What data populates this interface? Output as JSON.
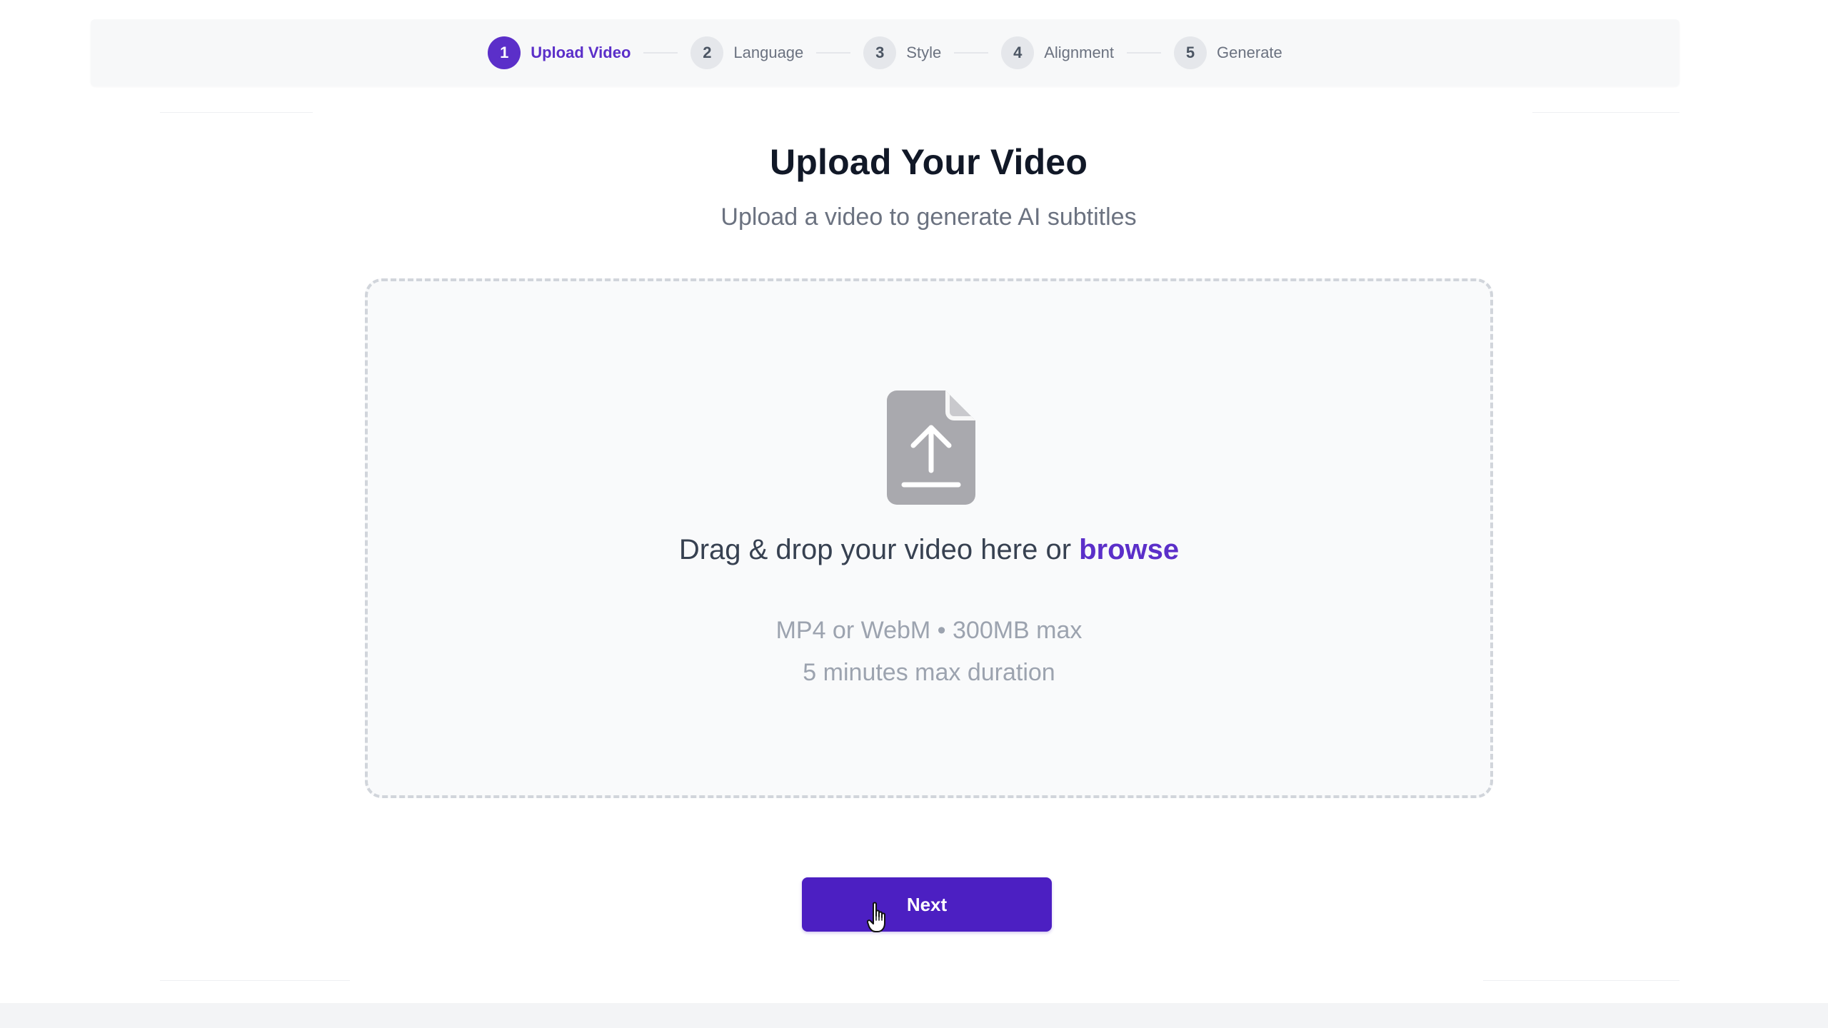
{
  "stepper": {
    "steps": [
      {
        "number": "1",
        "label": "Upload Video",
        "active": true
      },
      {
        "number": "2",
        "label": "Language",
        "active": false
      },
      {
        "number": "3",
        "label": "Style",
        "active": false
      },
      {
        "number": "4",
        "label": "Alignment",
        "active": false
      },
      {
        "number": "5",
        "label": "Generate",
        "active": false
      }
    ]
  },
  "header": {
    "title": "Upload Your Video",
    "subtitle": "Upload a video to generate AI subtitles"
  },
  "dropzone": {
    "icon": "file-upload-icon",
    "prompt_text": "Drag & drop your video here or ",
    "browse_label": "browse",
    "formats_text": "MP4 or WebM • 300MB max",
    "duration_text": "5 minutes max duration"
  },
  "actions": {
    "next_label": "Next"
  },
  "colors": {
    "accent": "#5b2fc9",
    "button": "#4c1fc2",
    "step_inactive": "#e5e7eb",
    "muted_text": "#9ca3af"
  }
}
